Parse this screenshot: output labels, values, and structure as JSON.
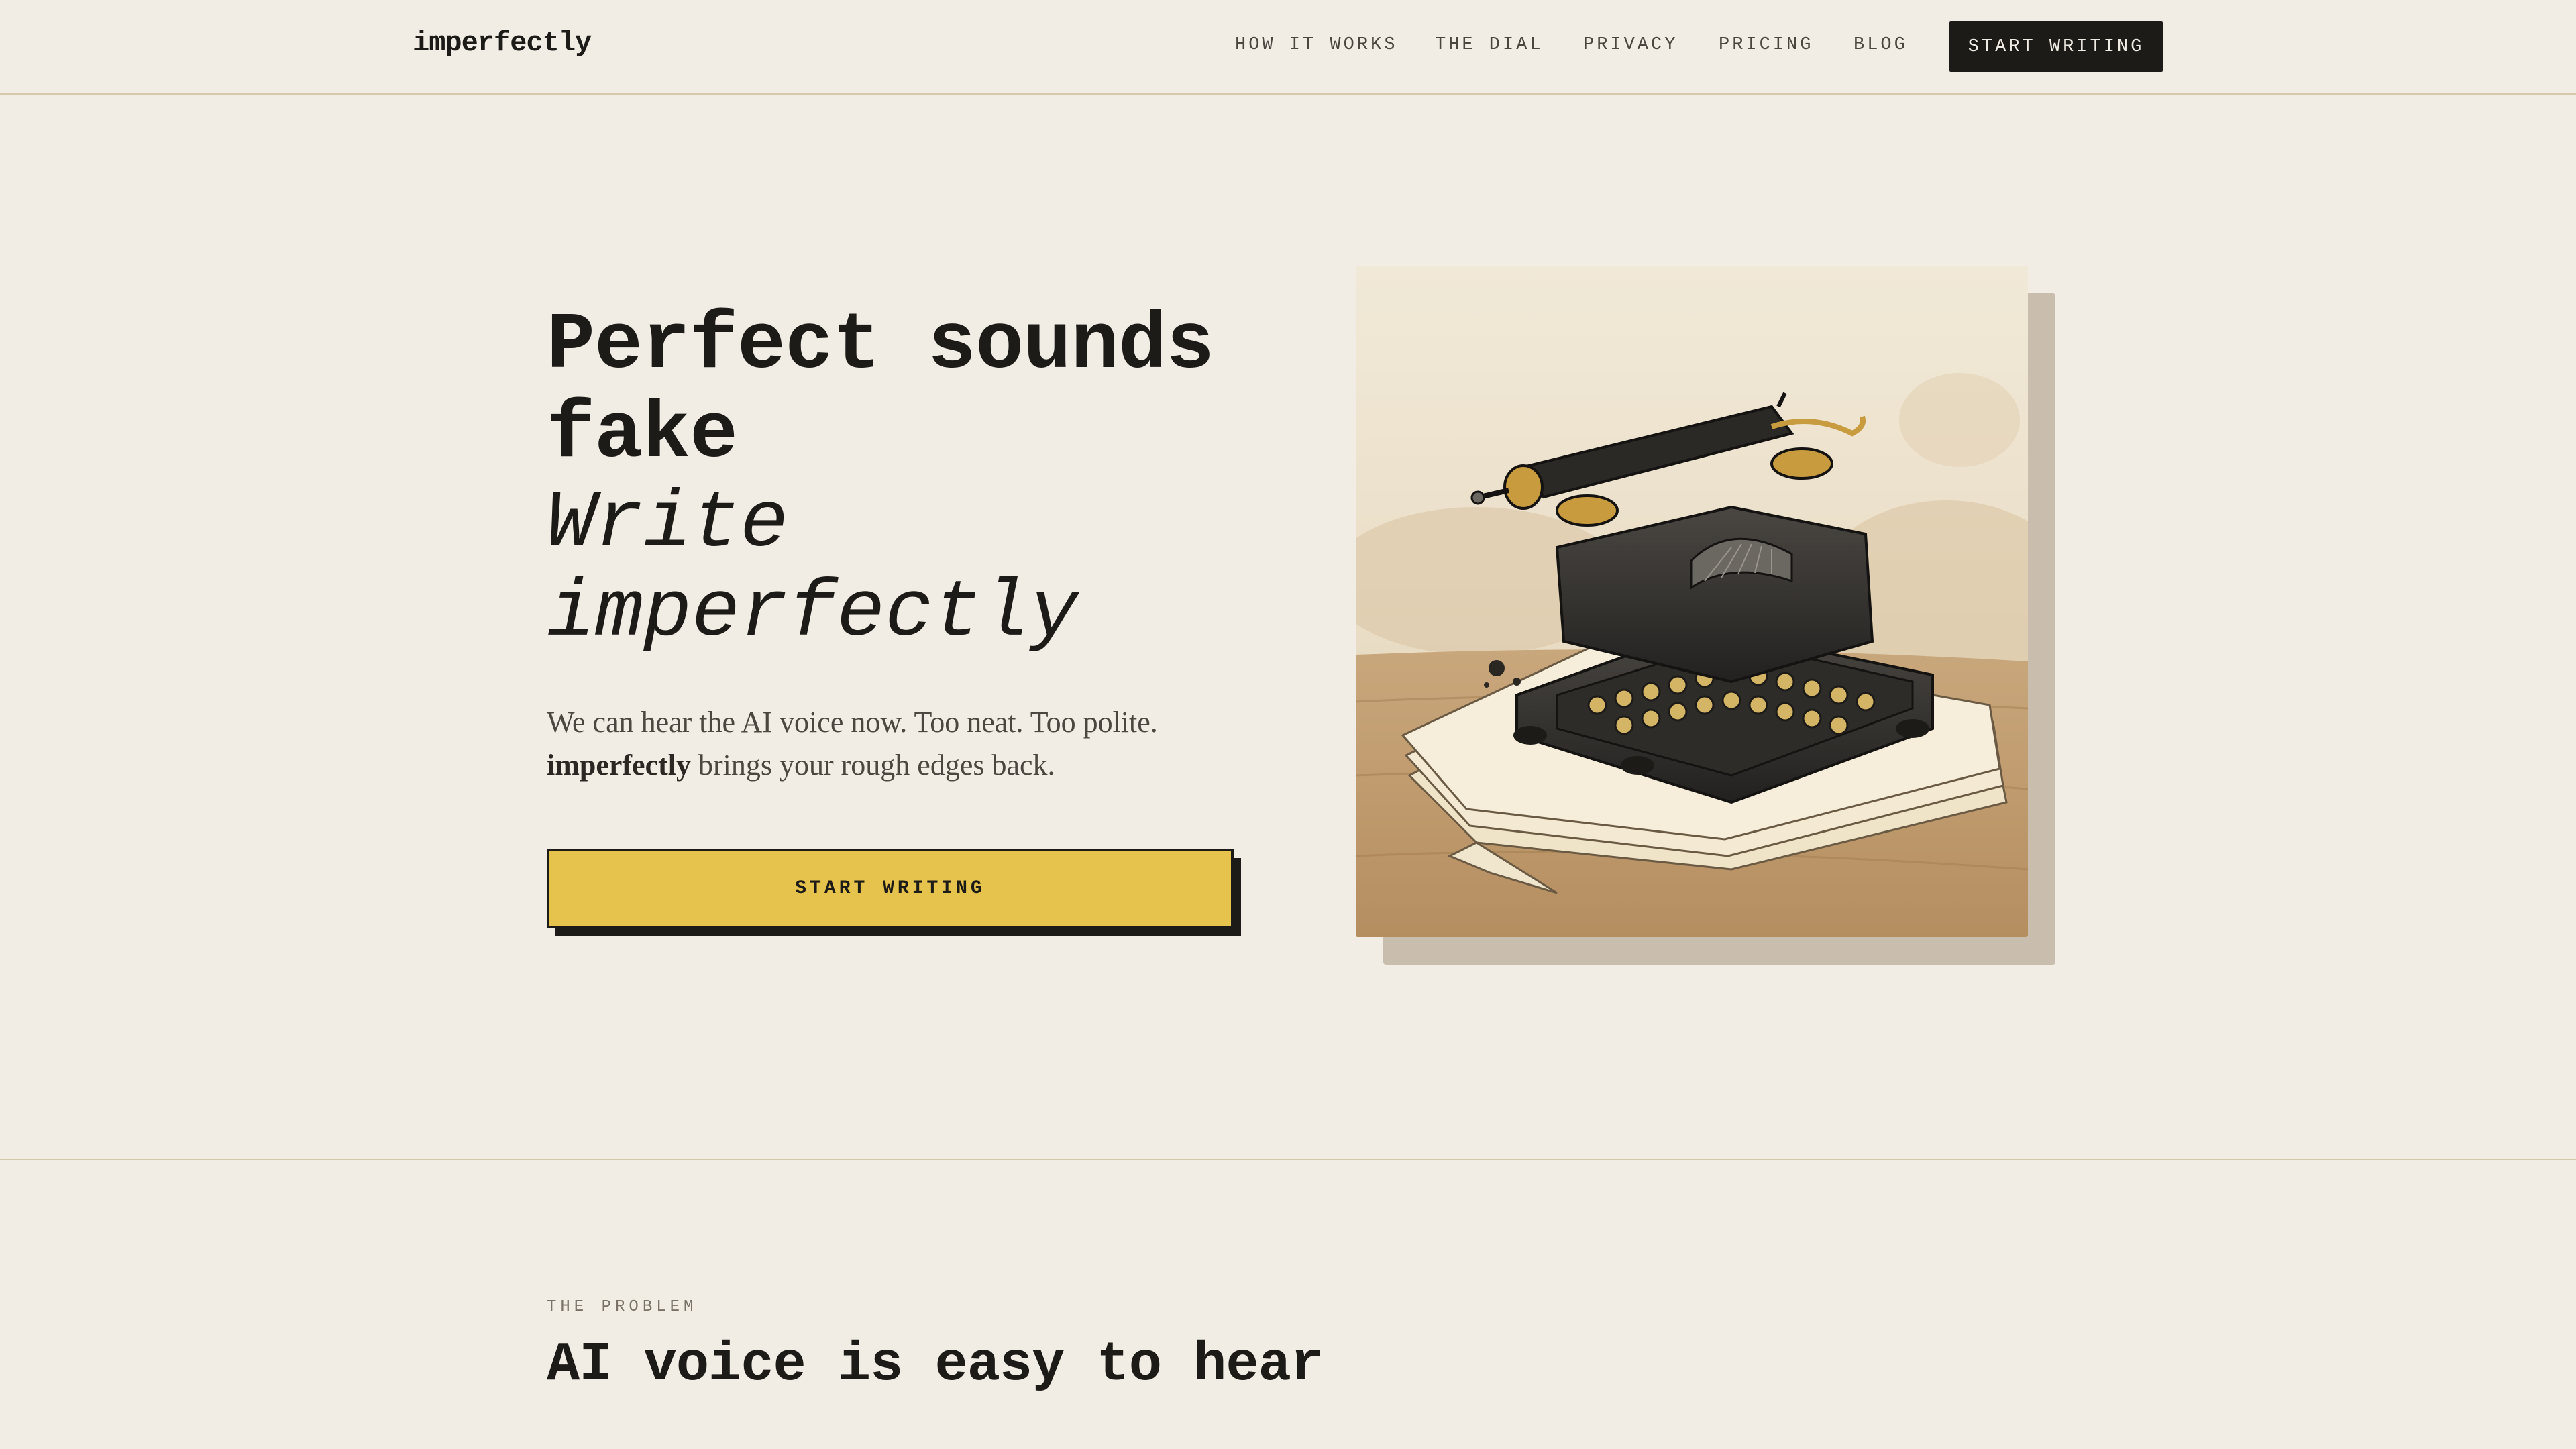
{
  "header": {
    "logo": "imperfectly",
    "nav": [
      {
        "label": "HOW IT WORKS"
      },
      {
        "label": "THE DIAL"
      },
      {
        "label": "PRIVACY"
      },
      {
        "label": "PRICING"
      },
      {
        "label": "BLOG"
      }
    ],
    "cta_label": "START WRITING"
  },
  "hero": {
    "title_line1": "Perfect sounds",
    "title_line2": "fake",
    "title_line3": "Write",
    "title_line4": "imperfectly",
    "subtitle_line1": "We can hear the AI voice now. Too neat. Too polite.",
    "subtitle_brand": "imperfectly",
    "subtitle_rest": " brings your rough edges back.",
    "cta_label": "START WRITING",
    "illustration": "typewriter-illustration"
  },
  "problem": {
    "eyebrow": "THE PROBLEM",
    "title": "AI voice is easy to hear"
  },
  "colors": {
    "background": "#f2ede4",
    "ink": "#1d1b18",
    "accent": "#e6c34c",
    "rule": "#d3c9a8"
  }
}
